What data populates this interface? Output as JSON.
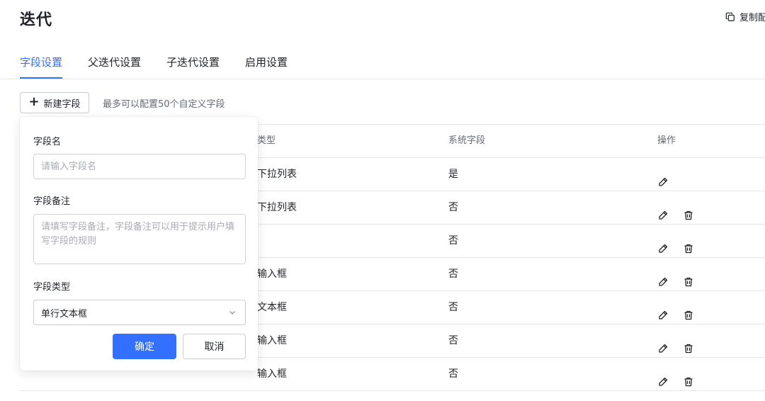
{
  "page": {
    "title": "迭代",
    "copy_label": "复制配"
  },
  "tabs": [
    {
      "label": "字段设置",
      "active": true
    },
    {
      "label": "父迭代设置",
      "active": false
    },
    {
      "label": "子迭代设置",
      "active": false
    },
    {
      "label": "启用设置",
      "active": false
    }
  ],
  "toolbar": {
    "new_field_label": "新建字段",
    "hint": "最多可以配置50个自定义字段"
  },
  "table": {
    "columns": {
      "type": "类型",
      "system": "系统字段",
      "ops": "操作"
    },
    "rows": [
      {
        "name": "",
        "type": "下拉列表",
        "system": "是",
        "deletable": false
      },
      {
        "name": "",
        "type": "下拉列表",
        "system": "否",
        "deletable": true
      },
      {
        "name": "",
        "type": "",
        "system": "否",
        "deletable": true
      },
      {
        "name": "",
        "type": "输入框",
        "system": "否",
        "deletable": true
      },
      {
        "name": "",
        "type": "文本框",
        "system": "否",
        "deletable": true
      },
      {
        "name": "",
        "type": "输入框",
        "system": "否",
        "deletable": true
      },
      {
        "name": "",
        "type": "输入框",
        "system": "否",
        "deletable": true
      }
    ]
  },
  "popover": {
    "name_label": "字段名",
    "name_placeholder": "请输入字段名",
    "note_label": "字段备注",
    "note_placeholder": "请填写字段备注，字段备注可以用于提示用户填写字段的规则",
    "type_label": "字段类型",
    "type_value": "单行文本框",
    "confirm_label": "确定",
    "cancel_label": "取消"
  },
  "icons": {
    "copy": "copy-icon",
    "plus": "plus-icon",
    "edit": "pencil-icon",
    "delete": "trash-icon",
    "dropdown": "chevron-down-icon"
  },
  "colors": {
    "accent": "#3370ff",
    "text": "#1f2329",
    "muted": "#646a73",
    "border": "#e5e6eb"
  }
}
